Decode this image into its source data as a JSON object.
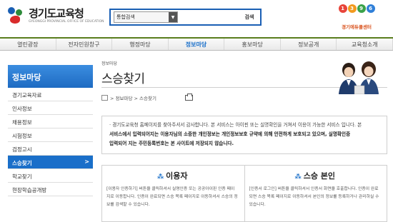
{
  "header": {
    "logo_title": "경기도교육청",
    "logo_sub": "GYEONGGI PROVINCIAL OFFICE OF EDUCATION",
    "search_select": "통합검색",
    "search_button": "검색",
    "center_digits": [
      "1",
      "3",
      "9",
      "6"
    ],
    "center_label": "경기에듀콜센터"
  },
  "gnb": {
    "items": [
      {
        "label": "열린광장",
        "active": false
      },
      {
        "label": "전자민원창구",
        "active": false
      },
      {
        "label": "행정마당",
        "active": false
      },
      {
        "label": "정보마당",
        "active": true
      },
      {
        "label": "홍보마당",
        "active": false
      },
      {
        "label": "정보공개",
        "active": false
      },
      {
        "label": "교육청소개",
        "active": false
      }
    ]
  },
  "sidebar": {
    "title": "정보마당",
    "items": [
      {
        "label": "경기교육자료",
        "active": false
      },
      {
        "label": "인사정보",
        "active": false
      },
      {
        "label": "채용정보",
        "active": false
      },
      {
        "label": "시험정보",
        "active": false
      },
      {
        "label": "검정고시",
        "active": false
      },
      {
        "label": "스승찾기",
        "active": true
      },
      {
        "label": "학교찾기",
        "active": false
      },
      {
        "label": "현장학습공개방",
        "active": false
      }
    ]
  },
  "main": {
    "section_small": "정보마당",
    "title": "스승찾기",
    "breadcrumb": "> 정보마당 > 스승찾기",
    "notice_line1": "· 경기도교육청 홈페이지를 찾아주셔서 감사합니다. 본 서비스는 아이핀 또는 실명확인을 거쳐서 이용이 가능한 서비스 입니다. 본",
    "notice_line2": "서비스에서 입력되어지는 이용자님의 소중한 개인정보는 개인정보보호 규약에 의해 안전하게 보호되고 있으며, 실명확인증",
    "notice_line3": "입력되어 지는 주민등록번호는 본 사이트에 저장되지 않습니다.",
    "cards": [
      {
        "title": "이용자",
        "desc": "[이용자 인증하기] 버튼을 클릭하셔서 실명인증 또는 공공아이핀 인증 페이지로 이동합니다. 인증이 완료되면 스승 목록 페이지로 이동하셔서 스승의 정보를 검색할 수 있습니다."
      },
      {
        "title": "스승 본인",
        "desc": "[인증서 로그인] 버튼을 클릭하셔서 인증서 화면을 호출합니다. 인증이 완료되면 스승 목록 페이지로 이동하셔서 본인의 정보를 등록하거나 관리하실 수 있습니다."
      }
    ]
  },
  "colors": {
    "brand_blue": "#1a6fc9",
    "gnb_green": "#5a7e1e",
    "badge_orange": "#d9531e"
  }
}
